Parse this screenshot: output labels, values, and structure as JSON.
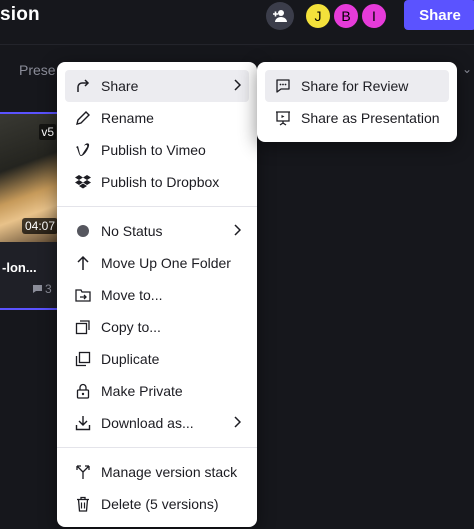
{
  "header": {
    "title": "sion",
    "share_label": "Share",
    "avatars": [
      {
        "initial": "J",
        "color": "#f3e13b"
      },
      {
        "initial": "B",
        "color": "#e63bd9"
      },
      {
        "initial": "I",
        "color": "#e63bd9"
      }
    ]
  },
  "toolbar": {
    "present_label": "Prese"
  },
  "card": {
    "version": "v5",
    "duration": "04:07",
    "title": "-lon...",
    "comments": "3"
  },
  "menu": {
    "items": [
      {
        "label": "Share",
        "icon": "share-arrow-icon",
        "submenu": true
      },
      {
        "label": "Rename",
        "icon": "pencil-icon"
      },
      {
        "label": "Publish to Vimeo",
        "icon": "vimeo-icon"
      },
      {
        "label": "Publish to Dropbox",
        "icon": "dropbox-icon"
      },
      {
        "label": "No Status",
        "icon": "status-dot-icon",
        "submenu": true
      },
      {
        "label": "Move Up One Folder",
        "icon": "arrow-up-icon"
      },
      {
        "label": "Move to...",
        "icon": "move-folder-icon"
      },
      {
        "label": "Copy to...",
        "icon": "copy-icon"
      },
      {
        "label": "Duplicate",
        "icon": "duplicate-icon"
      },
      {
        "label": "Make Private",
        "icon": "lock-icon"
      },
      {
        "label": "Download as...",
        "icon": "download-icon",
        "submenu": true
      },
      {
        "label": "Manage version stack",
        "icon": "version-stack-icon"
      },
      {
        "label": "Delete (5 versions)",
        "icon": "trash-icon"
      }
    ]
  },
  "submenu": {
    "items": [
      {
        "label": "Share for Review",
        "icon": "comment-review-icon"
      },
      {
        "label": "Share as Presentation",
        "icon": "presentation-icon"
      }
    ]
  }
}
